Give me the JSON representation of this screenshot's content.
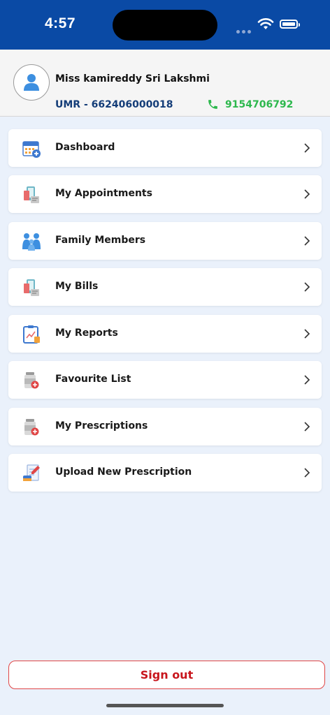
{
  "status_bar": {
    "time": "4:57"
  },
  "profile": {
    "name": "Miss kamireddy Sri Lakshmi",
    "umr": "UMR - 662406000018",
    "phone": "9154706792"
  },
  "menu": [
    {
      "label": "Dashboard",
      "icon": "calendar-icon"
    },
    {
      "label": "My Appointments",
      "icon": "appointment-icon"
    },
    {
      "label": "Family Members",
      "icon": "family-icon"
    },
    {
      "label": "My Bills",
      "icon": "bill-icon"
    },
    {
      "label": "My Reports",
      "icon": "report-icon"
    },
    {
      "label": "Favourite List",
      "icon": "medicine-icon"
    },
    {
      "label": "My Prescriptions",
      "icon": "prescription-icon"
    },
    {
      "label": "Upload New Prescription",
      "icon": "upload-prescription-icon"
    }
  ],
  "signout_label": "Sign out",
  "colors": {
    "header_bg": "#0a4aa5",
    "page_bg": "#eaf1fb",
    "umr_text": "#143d78",
    "phone_text": "#2db84d",
    "signout_text": "#c8161d"
  }
}
